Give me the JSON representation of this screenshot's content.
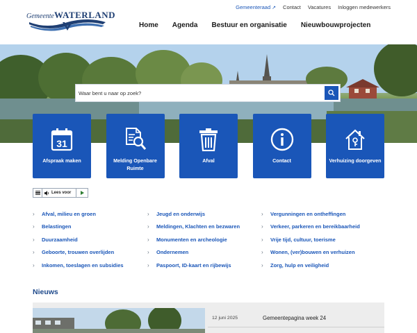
{
  "brand": {
    "logo_small": "Gemeente",
    "logo_big": "WATERLAND"
  },
  "utility_nav": [
    {
      "label": "Gemeenteraad",
      "external": true
    },
    {
      "label": "Contact"
    },
    {
      "label": "Vacatures"
    },
    {
      "label": "Inloggen medewerkers"
    }
  ],
  "main_nav": [
    {
      "label": "Home"
    },
    {
      "label": "Agenda"
    },
    {
      "label": "Bestuur en organisatie"
    },
    {
      "label": "Nieuwbouwprojecten"
    }
  ],
  "search": {
    "placeholder": "Waar bent u naar op zoek?",
    "value": ""
  },
  "tiles": [
    {
      "label": "Afspraak maken",
      "icon": "calendar-icon",
      "icon_text": "31"
    },
    {
      "label": "Melding Openbare Ruimte",
      "icon": "document-search-icon"
    },
    {
      "label": "Afval",
      "icon": "trash-bin-icon"
    },
    {
      "label": "Contact",
      "icon": "info-icon"
    },
    {
      "label": "Verhuizing doorgeven",
      "icon": "house-icon"
    }
  ],
  "read_aloud": {
    "label": "Lees voor"
  },
  "topic_links": {
    "col1": [
      {
        "label": "Afval, milieu en groen"
      },
      {
        "label": "Belastingen"
      },
      {
        "label": "Duurzaamheid"
      },
      {
        "label": "Geboorte, trouwen overlijden"
      },
      {
        "label": "Inkomen, toeslagen en subsidies"
      }
    ],
    "col2": [
      {
        "label": "Jeugd en onderwijs"
      },
      {
        "label": "Meldingen, Klachten en bezwaren"
      },
      {
        "label": "Monumenten en archeologie"
      },
      {
        "label": "Ondernemen"
      },
      {
        "label": "Paspoort, ID-kaart en rijbewijs"
      }
    ],
    "col3": [
      {
        "label": "Vergunningen en ontheffingen"
      },
      {
        "label": "Verkeer, parkeren en bereikbaarheid"
      },
      {
        "label": "Vrije tijd, cultuur, toerisme"
      },
      {
        "label": "Wonen, (ver)bouwen en verhuizen"
      },
      {
        "label": "Zorg, hulp en veiligheid"
      }
    ]
  },
  "news": {
    "title": "Nieuws",
    "items": [
      {
        "date": "12 juni 2025",
        "headline": "Gemeentepagina week 24"
      }
    ]
  },
  "colors": {
    "primary": "#1a56b8",
    "tile_bg": "#1a56b8",
    "news_bg": "#ededed",
    "heading": "#1f4a8c"
  }
}
